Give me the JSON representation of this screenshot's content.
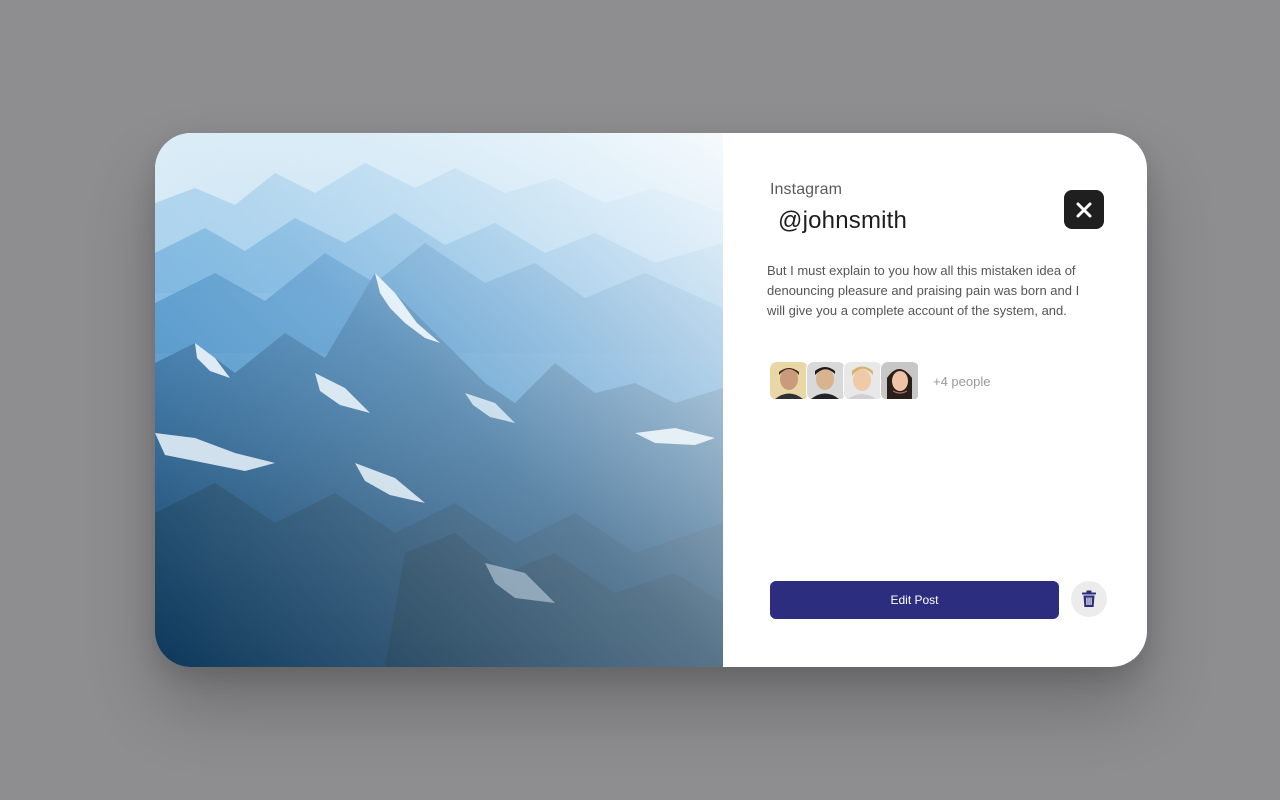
{
  "post": {
    "platform": "Instagram",
    "handle": "@johnsmith",
    "description": "But I must explain to you how all this mistaken idea of denouncing pleasure and praising pain was born and I will give you a complete account of the system, and.",
    "image_icon": "mountain-landscape-photo"
  },
  "people": {
    "avatars": [
      {
        "name": "avatar-1",
        "icon": "person-avatar"
      },
      {
        "name": "avatar-2",
        "icon": "person-avatar"
      },
      {
        "name": "avatar-3",
        "icon": "person-avatar"
      },
      {
        "name": "avatar-4",
        "icon": "person-avatar"
      }
    ],
    "more_label": "+4 people"
  },
  "actions": {
    "edit_label": "Edit Post",
    "close_icon": "close-icon",
    "delete_icon": "trash-icon"
  },
  "colors": {
    "primary": "#2c2d7f",
    "close_bg": "#1f1f1f",
    "backdrop": "#8e8e90"
  }
}
